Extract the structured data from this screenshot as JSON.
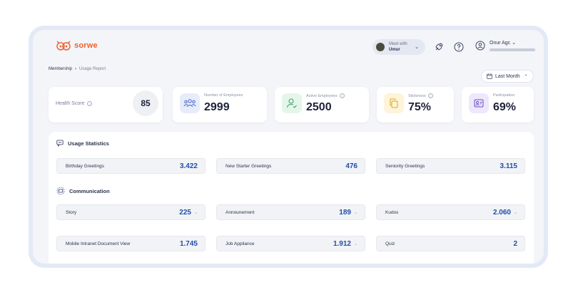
{
  "brand": {
    "name": "sorwe",
    "color": "#f0622d"
  },
  "header": {
    "meet_label": "Meet with",
    "meet_name": "Umur",
    "icons": [
      "rocket-icon",
      "help-icon",
      "user-icon"
    ],
    "user_name": "Onur Agc"
  },
  "breadcrumb": {
    "parent": "Membership",
    "separator": "›",
    "current": "Usage Report"
  },
  "date_range": {
    "label": "Last Month"
  },
  "health": {
    "label": "Health Score",
    "score": "85"
  },
  "metrics": [
    {
      "label": "Number of Employees",
      "value": "2999",
      "icon": "people-icon",
      "tint": "#e7ecfb",
      "color": "#3f66c7"
    },
    {
      "label": "Active Employees",
      "value": "2500",
      "icon": "user-check-icon",
      "tint": "#e4f6ea",
      "color": "#34a065"
    },
    {
      "label": "Stickiness",
      "value": "75%",
      "icon": "copy-icon",
      "tint": "#fdf4d9",
      "color": "#e0a81c"
    },
    {
      "label": "Participation",
      "value": "69%",
      "icon": "id-card-icon",
      "tint": "#ede8fb",
      "color": "#6b4cc4"
    }
  ],
  "usage_statistics": {
    "title": "Usage Statistics",
    "items": [
      {
        "label": "Birthday Greetings",
        "value": "3.422"
      },
      {
        "label": "New Starter Greetings",
        "value": "476"
      },
      {
        "label": "Seniority Greetings",
        "value": "3.115"
      }
    ]
  },
  "communication": {
    "title": "Communication",
    "items": [
      {
        "label": "Story",
        "value": "225",
        "dropdown": "⌄"
      },
      {
        "label": "Announement",
        "value": "189",
        "dropdown": "⌄"
      },
      {
        "label": "Kudos",
        "value": "2.060",
        "dropdown": "⌄"
      },
      {
        "label": "Mobile Intranet Document View",
        "value": "1.745",
        "dropdown": ""
      },
      {
        "label": "Job Appliance",
        "value": "1.912",
        "dropdown": "⌄"
      },
      {
        "label": "Quiz",
        "value": "2",
        "dropdown": ""
      }
    ]
  },
  "accent_value_color": "#1f4ea8"
}
